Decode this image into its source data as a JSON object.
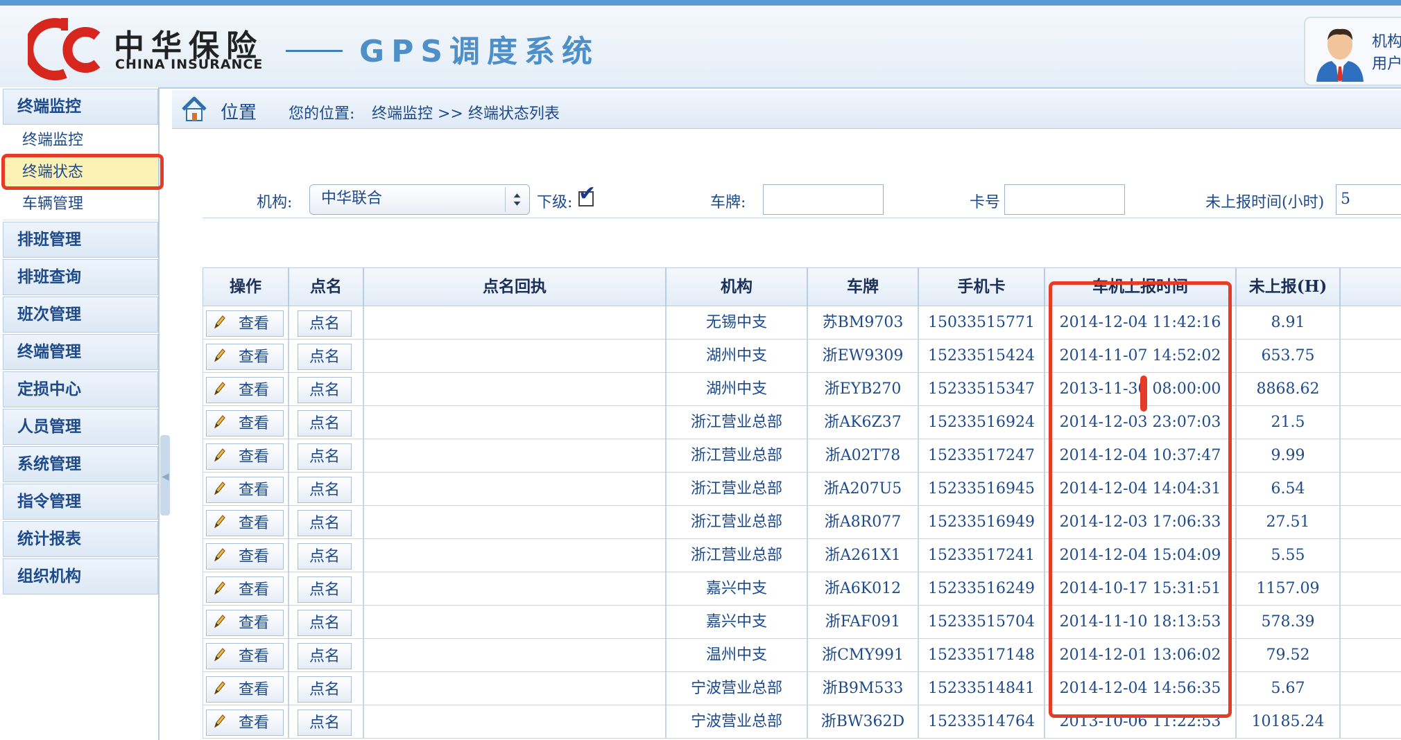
{
  "header": {
    "logo_cn": "中华保险",
    "logo_en": "CHINA INSURANCE",
    "system_title": "GPS调度系统",
    "user_line1": "机构",
    "user_line2": "用户"
  },
  "sidebar": {
    "groups": [
      {
        "label": "终端监控"
      },
      {
        "label": "排班管理"
      },
      {
        "label": "排班查询"
      },
      {
        "label": "班次管理"
      },
      {
        "label": "终端管理"
      },
      {
        "label": "定损中心"
      },
      {
        "label": "人员管理"
      },
      {
        "label": "系统管理"
      },
      {
        "label": "指令管理"
      },
      {
        "label": "统计报表"
      },
      {
        "label": "组织机构"
      }
    ],
    "sub_items": [
      {
        "label": "终端监控"
      },
      {
        "label": "终端状态",
        "active": true
      },
      {
        "label": "车辆管理"
      }
    ]
  },
  "breadcrumb": {
    "title": "位置",
    "label": "您的位置:",
    "path": "终端监控 >> 终端状态列表"
  },
  "filters": {
    "org_label": "机构:",
    "org_value": "中华联合",
    "sub_label": "下级:",
    "sub_checked": true,
    "plate_label": "车牌:",
    "plate_value": "",
    "card_label": "卡号",
    "card_value": "",
    "unreported_label": "未上报时间(小时)",
    "unreported_value": "5"
  },
  "table": {
    "headers": [
      "操作",
      "点名",
      "点名回执",
      "机构",
      "车牌",
      "手机卡",
      "车机上报时间",
      "未上报(H)"
    ],
    "view_label": "查看",
    "rollcall_label": "点名",
    "rows": [
      {
        "org": "无锡中支",
        "plate": "苏BM9703",
        "sim": "15033515771",
        "time": "2014-12-04 11:42:16",
        "hours": "8.91"
      },
      {
        "org": "湖州中支",
        "plate": "浙EW9309",
        "sim": "15233515424",
        "time": "2014-11-07 14:52:02",
        "hours": "653.75"
      },
      {
        "org": "湖州中支",
        "plate": "浙EYB270",
        "sim": "15233515347",
        "time": "2013-11-30 08:00:00",
        "hours": "8868.62"
      },
      {
        "org": "浙江营业总部",
        "plate": "浙AK6Z37",
        "sim": "15233516924",
        "time": "2014-12-03 23:07:03",
        "hours": "21.5"
      },
      {
        "org": "浙江营业总部",
        "plate": "浙A02T78",
        "sim": "15233517247",
        "time": "2014-12-04 10:37:47",
        "hours": "9.99"
      },
      {
        "org": "浙江营业总部",
        "plate": "浙A207U5",
        "sim": "15233516945",
        "time": "2014-12-04 14:04:31",
        "hours": "6.54"
      },
      {
        "org": "浙江营业总部",
        "plate": "浙A8R077",
        "sim": "15233516949",
        "time": "2014-12-03 17:06:33",
        "hours": "27.51"
      },
      {
        "org": "浙江营业总部",
        "plate": "浙A261X1",
        "sim": "15233517241",
        "time": "2014-12-04 15:04:09",
        "hours": "5.55"
      },
      {
        "org": "嘉兴中支",
        "plate": "浙A6K012",
        "sim": "15233516249",
        "time": "2014-10-17 15:31:51",
        "hours": "1157.09"
      },
      {
        "org": "嘉兴中支",
        "plate": "浙FAF091",
        "sim": "15233515704",
        "time": "2014-11-10 18:13:53",
        "hours": "578.39"
      },
      {
        "org": "温州中支",
        "plate": "浙CMY991",
        "sim": "15233517148",
        "time": "2014-12-01 13:06:02",
        "hours": "79.52"
      },
      {
        "org": "宁波营业总部",
        "plate": "浙B9M533",
        "sim": "15233514841",
        "time": "2014-12-04 14:56:35",
        "hours": "5.67"
      },
      {
        "org": "宁波营业总部",
        "plate": "浙BW362D",
        "sim": "15233514764",
        "time": "2013-10-06 11:22:53",
        "hours": "10185.24"
      }
    ]
  },
  "colors": {
    "highlight": "#e63b24",
    "active_menu": "#fdf2b5",
    "brand_red": "#d7261e",
    "title_blue": "#4d8fc6"
  }
}
